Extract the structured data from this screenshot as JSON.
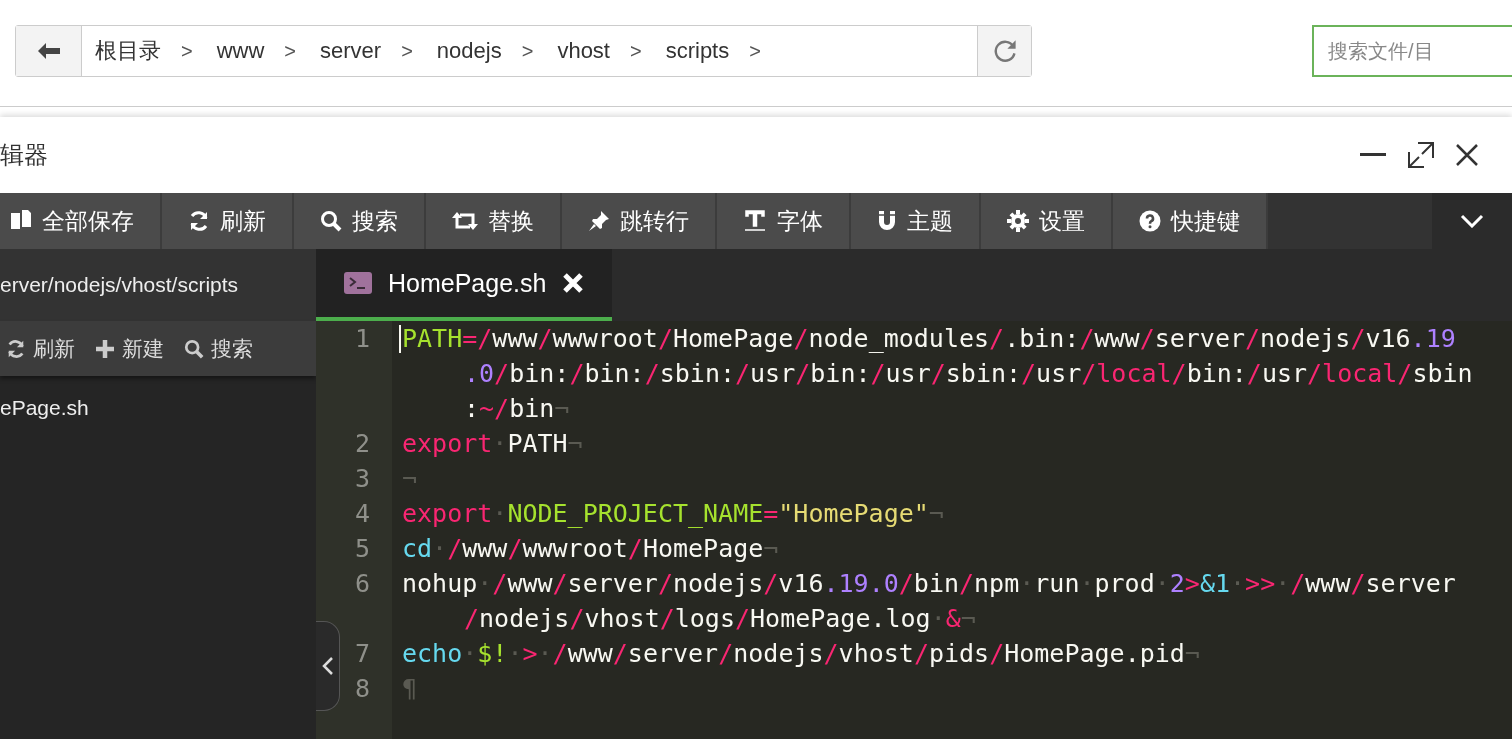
{
  "breadcrumb": {
    "items": [
      "根目录",
      "www",
      "server",
      "nodejs",
      "vhost",
      "scripts"
    ],
    "separator": ">"
  },
  "search": {
    "placeholder": "搜索文件/目"
  },
  "editor_window": {
    "title": "辑器"
  },
  "toolbar": [
    {
      "label": "全部保存"
    },
    {
      "label": "刷新"
    },
    {
      "label": "搜索"
    },
    {
      "label": "替换"
    },
    {
      "label": "跳转行"
    },
    {
      "label": "字体"
    },
    {
      "label": "主题"
    },
    {
      "label": "设置"
    },
    {
      "label": "快捷键"
    }
  ],
  "sidebar": {
    "path": "erver/nodejs/vhost/scripts",
    "actions": [
      {
        "label": "刷新"
      },
      {
        "label": "新建"
      },
      {
        "label": "搜索"
      }
    ],
    "files": [
      {
        "name": "ePage.sh",
        "selected": false
      }
    ]
  },
  "tabs": [
    {
      "label": "HomePage.sh",
      "selected": true
    }
  ],
  "code_lines": [
    {
      "number": "1",
      "rows": [
        {
          "tokens": [
            {
              "text": "PATH",
              "kind": "variable"
            },
            {
              "text": "=/",
              "kind": "operator"
            },
            {
              "text": "www",
              "kind": "plain"
            },
            {
              "text": "/",
              "kind": "operator"
            },
            {
              "text": "wwwroot",
              "kind": "plain"
            },
            {
              "text": "/",
              "kind": "operator"
            },
            {
              "text": "HomePage",
              "kind": "plain"
            },
            {
              "text": "/",
              "kind": "operator"
            },
            {
              "text": "node_modules",
              "kind": "plain"
            },
            {
              "text": "/",
              "kind": "operator"
            },
            {
              "text": ".bin:",
              "kind": "plain"
            },
            {
              "text": "/",
              "kind": "operator"
            },
            {
              "text": "www",
              "kind": "plain"
            },
            {
              "text": "/",
              "kind": "operator"
            },
            {
              "text": "server",
              "kind": "plain"
            },
            {
              "text": "/",
              "kind": "operator"
            },
            {
              "text": "nodejs",
              "kind": "plain"
            },
            {
              "text": "/",
              "kind": "operator"
            },
            {
              "text": "v16",
              "kind": "plain"
            },
            {
              "text": ".19",
              "kind": "number"
            }
          ]
        },
        {
          "tokens": [
            {
              "text": ".0",
              "kind": "number"
            },
            {
              "text": "/",
              "kind": "operator"
            },
            {
              "text": "bin:",
              "kind": "plain"
            },
            {
              "text": "/",
              "kind": "operator"
            },
            {
              "text": "bin:",
              "kind": "plain"
            },
            {
              "text": "/",
              "kind": "operator"
            },
            {
              "text": "sbin:",
              "kind": "plain"
            },
            {
              "text": "/",
              "kind": "operator"
            },
            {
              "text": "usr",
              "kind": "plain"
            },
            {
              "text": "/",
              "kind": "operator"
            },
            {
              "text": "bin:",
              "kind": "plain"
            },
            {
              "text": "/",
              "kind": "operator"
            },
            {
              "text": "usr",
              "kind": "plain"
            },
            {
              "text": "/",
              "kind": "operator"
            },
            {
              "text": "sbin:",
              "kind": "plain"
            },
            {
              "text": "/",
              "kind": "operator"
            },
            {
              "text": "usr",
              "kind": "plain"
            },
            {
              "text": "/local/",
              "kind": "operator"
            },
            {
              "text": "bin:",
              "kind": "plain"
            },
            {
              "text": "/",
              "kind": "operator"
            },
            {
              "text": "usr",
              "kind": "plain"
            },
            {
              "text": "/local/",
              "kind": "operator"
            },
            {
              "text": "sbin",
              "kind": "plain"
            }
          ]
        },
        {
          "tokens": [
            {
              "text": ":",
              "kind": "plain"
            },
            {
              "text": "~/",
              "kind": "operator"
            },
            {
              "text": "bin",
              "kind": "plain"
            },
            {
              "text": "¬",
              "kind": "invisible"
            }
          ]
        }
      ]
    },
    {
      "number": "2",
      "rows": [
        {
          "tokens": [
            {
              "text": "export",
              "kind": "keyword"
            },
            {
              "text": "·",
              "kind": "invisible"
            },
            {
              "text": "PATH",
              "kind": "plain"
            },
            {
              "text": "¬",
              "kind": "invisible"
            }
          ]
        }
      ]
    },
    {
      "number": "3",
      "rows": [
        {
          "tokens": [
            {
              "text": "¬",
              "kind": "invisible"
            }
          ]
        }
      ]
    },
    {
      "number": "4",
      "rows": [
        {
          "tokens": [
            {
              "text": "export",
              "kind": "keyword"
            },
            {
              "text": "·",
              "kind": "invisible"
            },
            {
              "text": "NODE_PROJECT_NAME",
              "kind": "variable"
            },
            {
              "text": "=",
              "kind": "operator"
            },
            {
              "text": "\"HomePage\"",
              "kind": "string"
            },
            {
              "text": "¬",
              "kind": "invisible"
            }
          ]
        }
      ]
    },
    {
      "number": "5",
      "rows": [
        {
          "tokens": [
            {
              "text": "cd",
              "kind": "builtin"
            },
            {
              "text": "·",
              "kind": "invisible"
            },
            {
              "text": "/",
              "kind": "operator"
            },
            {
              "text": "www",
              "kind": "plain"
            },
            {
              "text": "/",
              "kind": "operator"
            },
            {
              "text": "wwwroot",
              "kind": "plain"
            },
            {
              "text": "/",
              "kind": "operator"
            },
            {
              "text": "HomePage",
              "kind": "plain"
            },
            {
              "text": "¬",
              "kind": "invisible"
            }
          ]
        }
      ]
    },
    {
      "number": "6",
      "rows": [
        {
          "tokens": [
            {
              "text": "nohup",
              "kind": "plain"
            },
            {
              "text": "·",
              "kind": "invisible"
            },
            {
              "text": "/",
              "kind": "operator"
            },
            {
              "text": "www",
              "kind": "plain"
            },
            {
              "text": "/",
              "kind": "operator"
            },
            {
              "text": "server",
              "kind": "plain"
            },
            {
              "text": "/",
              "kind": "operator"
            },
            {
              "text": "nodejs",
              "kind": "plain"
            },
            {
              "text": "/",
              "kind": "operator"
            },
            {
              "text": "v16",
              "kind": "plain"
            },
            {
              "text": ".19.0",
              "kind": "number"
            },
            {
              "text": "/",
              "kind": "operator"
            },
            {
              "text": "bin",
              "kind": "plain"
            },
            {
              "text": "/",
              "kind": "operator"
            },
            {
              "text": "npm",
              "kind": "plain"
            },
            {
              "text": "·",
              "kind": "invisible"
            },
            {
              "text": "run",
              "kind": "plain"
            },
            {
              "text": "·",
              "kind": "invisible"
            },
            {
              "text": "prod",
              "kind": "plain"
            },
            {
              "text": "·",
              "kind": "invisible"
            },
            {
              "text": "2",
              "kind": "number"
            },
            {
              "text": ">",
              "kind": "operator"
            },
            {
              "text": "&1",
              "kind": "builtin"
            },
            {
              "text": "·",
              "kind": "invisible"
            },
            {
              "text": ">>",
              "kind": "operator"
            },
            {
              "text": "·",
              "kind": "invisible"
            },
            {
              "text": "/",
              "kind": "operator"
            },
            {
              "text": "www",
              "kind": "plain"
            },
            {
              "text": "/",
              "kind": "operator"
            },
            {
              "text": "server",
              "kind": "plain"
            }
          ]
        },
        {
          "tokens": [
            {
              "text": "/",
              "kind": "operator"
            },
            {
              "text": "nodejs",
              "kind": "plain"
            },
            {
              "text": "/",
              "kind": "operator"
            },
            {
              "text": "vhost",
              "kind": "plain"
            },
            {
              "text": "/",
              "kind": "operator"
            },
            {
              "text": "logs",
              "kind": "plain"
            },
            {
              "text": "/",
              "kind": "operator"
            },
            {
              "text": "HomePage.log",
              "kind": "plain"
            },
            {
              "text": "·",
              "kind": "invisible"
            },
            {
              "text": "&",
              "kind": "operator"
            },
            {
              "text": "¬",
              "kind": "invisible"
            }
          ]
        }
      ]
    },
    {
      "number": "7",
      "rows": [
        {
          "tokens": [
            {
              "text": "echo",
              "kind": "builtin"
            },
            {
              "text": "·",
              "kind": "invisible"
            },
            {
              "text": "$!",
              "kind": "variable"
            },
            {
              "text": "·",
              "kind": "invisible"
            },
            {
              "text": ">",
              "kind": "operator"
            },
            {
              "text": "·",
              "kind": "invisible"
            },
            {
              "text": "/",
              "kind": "operator"
            },
            {
              "text": "www",
              "kind": "plain"
            },
            {
              "text": "/",
              "kind": "operator"
            },
            {
              "text": "server",
              "kind": "plain"
            },
            {
              "text": "/",
              "kind": "operator"
            },
            {
              "text": "nodejs",
              "kind": "plain"
            },
            {
              "text": "/",
              "kind": "operator"
            },
            {
              "text": "vhost",
              "kind": "plain"
            },
            {
              "text": "/",
              "kind": "operator"
            },
            {
              "text": "pids",
              "kind": "plain"
            },
            {
              "text": "/",
              "kind": "operator"
            },
            {
              "text": "HomePage.pid",
              "kind": "plain"
            },
            {
              "text": "¬",
              "kind": "invisible"
            }
          ]
        }
      ]
    },
    {
      "number": "8",
      "rows": [
        {
          "tokens": [
            {
              "text": "¶",
              "kind": "invisible"
            }
          ]
        }
      ]
    }
  ]
}
